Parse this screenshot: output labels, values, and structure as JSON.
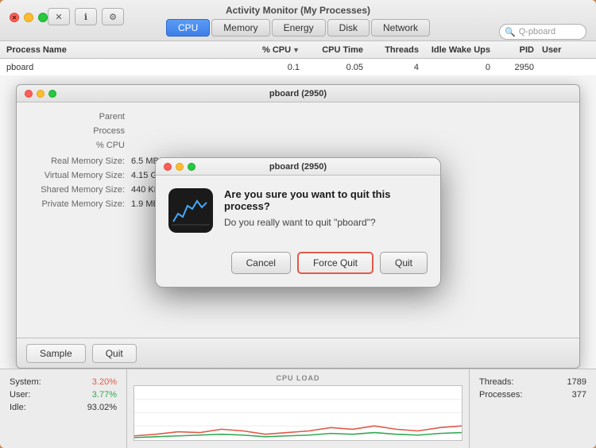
{
  "window": {
    "title": "Activity Monitor (My Processes)",
    "tabs": [
      "CPU",
      "Memory",
      "Energy",
      "Disk",
      "Network"
    ],
    "active_tab": "CPU",
    "search_placeholder": "Q-pboard",
    "toolbar_btns": [
      "✕",
      "ℹ",
      "⚙"
    ]
  },
  "columns": {
    "process_name": "Process Name",
    "cpu_pct": "% CPU",
    "cpu_time": "CPU Time",
    "threads": "Threads",
    "idle_wake_ups": "Idle Wake Ups",
    "pid": "PID",
    "user": "User"
  },
  "process_row": {
    "name": "pboard",
    "cpu_pct": "0.1",
    "cpu_time": "0.05",
    "threads": "4",
    "idle_wake_ups": "0",
    "pid": "2950"
  },
  "detail_panel": {
    "title": "pboard (2950)",
    "parent_label": "Parent",
    "process_label": "Process",
    "cpu_label": "% CPU",
    "real_memory_label": "Real Memory Size:",
    "real_memory_value": "6.5 MB",
    "virtual_memory_label": "Virtual Memory Size:",
    "virtual_memory_value": "4.15 GB",
    "shared_memory_label": "Shared Memory Size:",
    "shared_memory_value": "440 KB",
    "private_memory_label": "Private Memory Size:",
    "private_memory_value": "1.9 MB",
    "sample_btn": "Sample",
    "quit_btn": "Quit"
  },
  "quit_dialog": {
    "title": "pboard (2950)",
    "heading": "Are you sure you want to quit this process?",
    "subtext": "Do you really want to quit \"pboard\"?",
    "cancel_btn": "Cancel",
    "force_quit_btn": "Force Quit",
    "quit_btn": "Quit"
  },
  "stats_bar": {
    "system_label": "System:",
    "system_value": "3.20%",
    "user_label": "User:",
    "user_value": "3.77%",
    "idle_label": "Idle:",
    "idle_value": "93.02%",
    "cpu_load_label": "CPU LOAD",
    "threads_label": "Threads:",
    "threads_value": "1789",
    "processes_label": "Processes:",
    "processes_value": "377"
  }
}
